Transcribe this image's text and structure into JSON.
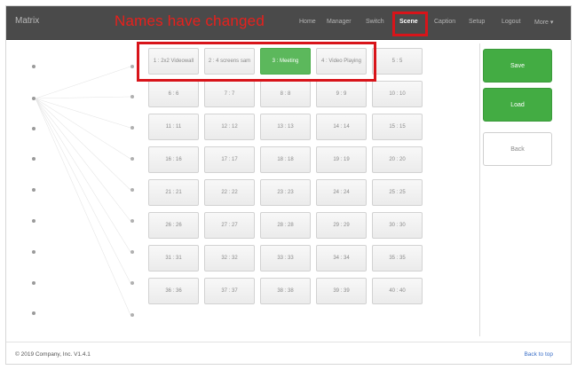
{
  "navbar": {
    "brand": "Matrix",
    "items": [
      {
        "label": "Home",
        "active": false
      },
      {
        "label": "Manager",
        "active": false
      },
      {
        "label": "Switch",
        "active": false
      },
      {
        "label": "Scene",
        "active": true
      },
      {
        "label": "Caption",
        "active": false
      },
      {
        "label": "Setup",
        "active": false
      },
      {
        "label": "Logout",
        "active": false
      },
      {
        "label": "More ▾",
        "active": false
      }
    ]
  },
  "annotation": {
    "text": "Names have changed",
    "color": "#e8201c"
  },
  "scenes": [
    [
      "1 : 2x2 Videowall",
      "2 : 4 screens sam",
      "3 : Meeting",
      "4 : Video Playing",
      "5 : 5"
    ],
    [
      "6 : 6",
      "7 : 7",
      "8 : 8",
      "9 : 9",
      "10 : 10"
    ],
    [
      "11 : 11",
      "12 : 12",
      "13 : 13",
      "14 : 14",
      "15 : 15"
    ],
    [
      "16 : 16",
      "17 : 17",
      "18 : 18",
      "19 : 19",
      "20 : 20"
    ],
    [
      "21 : 21",
      "22 : 22",
      "23 : 23",
      "24 : 24",
      "25 : 25"
    ],
    [
      "26 : 26",
      "27 : 27",
      "28 : 28",
      "29 : 29",
      "30 : 30"
    ],
    [
      "31 : 31",
      "32 : 32",
      "33 : 33",
      "34 : 34",
      "35 : 35"
    ],
    [
      "36 : 36",
      "37 : 37",
      "38 : 38",
      "39 : 39",
      "40 : 40"
    ]
  ],
  "active_scene": "3 : Meeting",
  "actions": {
    "save": "Save",
    "load": "Load",
    "back": "Back"
  },
  "footer": {
    "copyright": "© 2019 Company, Inc. V1.4.1",
    "back_to_top": "Back to top"
  },
  "colors": {
    "navbar": "#4a4a4a",
    "active_green": "#5cb85c",
    "annotation_red": "#d8141a"
  }
}
